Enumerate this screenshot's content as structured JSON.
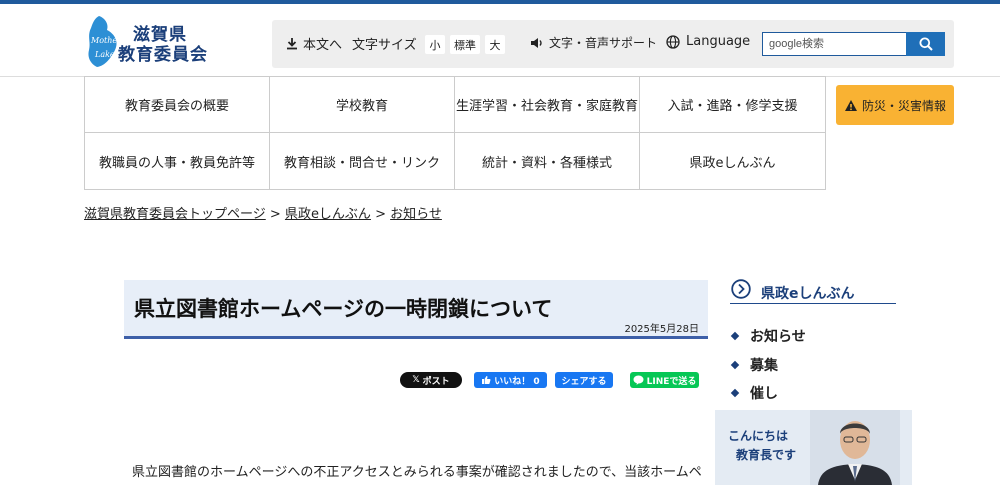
{
  "header": {
    "logo_title_line1": "滋賀県",
    "logo_title_line2": "教育委員会",
    "logo_mark_line1": "Mother",
    "logo_mark_line2": "Lake"
  },
  "toolbar": {
    "skip_to_content": "本文へ",
    "text_size_label": "文字サイズ",
    "size_small": "小",
    "size_standard": "標準",
    "size_large": "大",
    "voice_support": "文字・音声サポート",
    "language": "Language",
    "search_placeholder": "google検索"
  },
  "nav": {
    "row1": [
      "教育委員会の概要",
      "学校教育",
      "生涯学習・社会教育・家庭教育",
      "入試・進路・修学支援"
    ],
    "row2": [
      "教職員の人事・教員免許等",
      "教育相談・問合せ・リンク",
      "統計・資料・各種様式",
      "県政eしんぶん"
    ],
    "disaster": "防災・災害情報"
  },
  "breadcrumb": {
    "home": "滋賀県教育委員会トップページ",
    "sep": ">",
    "section": "県政eしんぶん",
    "current": "お知らせ"
  },
  "article": {
    "title": "県立図書館ホームページの一時閉鎖について",
    "date": "2025年5月28日",
    "body_first_line": "県立図書館のホームページへの不正アクセスとみられる事案が確認されましたので、当該ホームペ"
  },
  "share": {
    "x_post": "ポスト",
    "like": "いいね！ 0",
    "share": "シェアする",
    "line": "LINEで送る"
  },
  "sidebar": {
    "heading": "県政eしんぶん",
    "items": [
      "お知らせ",
      "募集",
      "催し"
    ],
    "banner_line1": "こんにちは",
    "banner_line2": "教育長です"
  },
  "colors": {
    "brand_blue": "#1b3f7a",
    "disaster_orange": "#f9b233",
    "title_bg": "#e7eef8",
    "facebook_blue": "#1877f2",
    "line_green": "#06c755"
  }
}
